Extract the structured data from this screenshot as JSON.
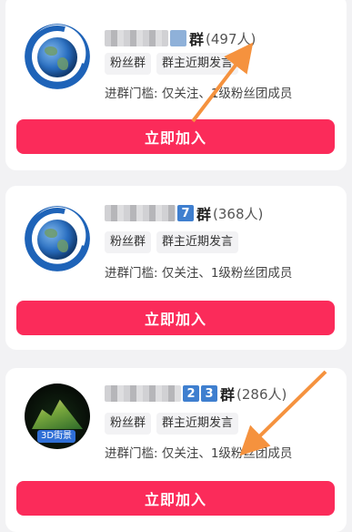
{
  "groups": [
    {
      "name_suffix": "群",
      "member_count": "(497人)",
      "tags": [
        "粉丝群",
        "群主近期发言"
      ],
      "threshold": "进群门槛: 仅关注、1级粉丝团成员",
      "join_label": "立即加入",
      "avatar": "earth-logo"
    },
    {
      "name_digit": "7",
      "name_suffix": "群",
      "member_count": "(368人)",
      "tags": [
        "粉丝群",
        "群主近期发言"
      ],
      "threshold": "进群门槛: 仅关注、1级粉丝团成员",
      "join_label": "立即加入",
      "avatar": "earth-logo"
    },
    {
      "name_digits": [
        "2",
        "3"
      ],
      "name_suffix": "群",
      "member_count": "(286人)",
      "tags": [
        "粉丝群",
        "群主近期发言"
      ],
      "threshold": "进群门槛: 仅关注、1级粉丝团成员",
      "join_label": "立即加入",
      "avatar": "3d-street-view-logo",
      "avatar_badge": "3D街景"
    }
  ],
  "colors": {
    "accent": "#fb2b5a",
    "annotation_arrow": "#f5923e",
    "number_badge": "#3f7fcf"
  }
}
